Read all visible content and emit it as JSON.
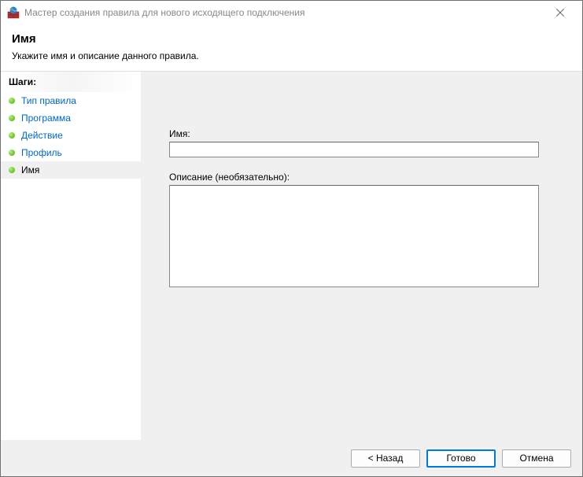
{
  "window": {
    "title": "Мастер создания правила для нового исходящего подключения"
  },
  "header": {
    "title": "Имя",
    "subtitle": "Укажите имя и описание данного правила."
  },
  "sidebar": {
    "steps_label": "Шаги:",
    "items": [
      {
        "label": "Тип правила"
      },
      {
        "label": "Программа"
      },
      {
        "label": "Действие"
      },
      {
        "label": "Профиль"
      },
      {
        "label": "Имя"
      }
    ]
  },
  "form": {
    "name_label": "Имя:",
    "name_value": "",
    "description_label": "Описание (необязательно):",
    "description_value": ""
  },
  "footer": {
    "back": "< Назад",
    "finish": "Готово",
    "cancel": "Отмена"
  }
}
